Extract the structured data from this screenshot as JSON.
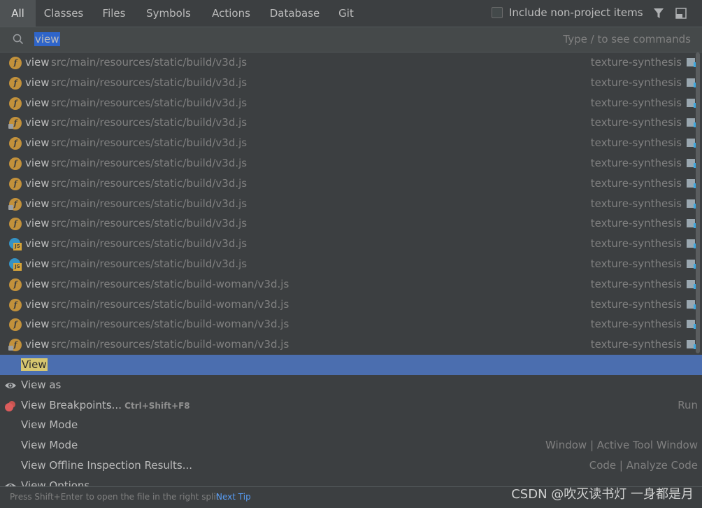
{
  "tabs": [
    {
      "label": "All",
      "active": true
    },
    {
      "label": "Classes"
    },
    {
      "label": "Files"
    },
    {
      "label": "Symbols"
    },
    {
      "label": "Actions"
    },
    {
      "label": "Database"
    },
    {
      "label": "Git"
    }
  ],
  "include_non_project": {
    "label": "Include non-project items",
    "checked": false
  },
  "search": {
    "value": "view",
    "hint": "Type / to see commands"
  },
  "results": [
    {
      "name": "view",
      "path": "src/main/resources/static/build/v3d.js",
      "module": "texture-synthesis",
      "icon": "function-icon"
    },
    {
      "name": "view",
      "path": "src/main/resources/static/build/v3d.js",
      "module": "texture-synthesis",
      "icon": "function-icon"
    },
    {
      "name": "view",
      "path": "src/main/resources/static/build/v3d.js",
      "module": "texture-synthesis",
      "icon": "function-icon"
    },
    {
      "name": "view",
      "path": "src/main/resources/static/build/v3d.js",
      "module": "texture-synthesis",
      "icon": "function-locked-icon"
    },
    {
      "name": "view",
      "path": "src/main/resources/static/build/v3d.js",
      "module": "texture-synthesis",
      "icon": "function-icon"
    },
    {
      "name": "view",
      "path": "src/main/resources/static/build/v3d.js",
      "module": "texture-synthesis",
      "icon": "function-icon"
    },
    {
      "name": "view",
      "path": "src/main/resources/static/build/v3d.js",
      "module": "texture-synthesis",
      "icon": "function-icon"
    },
    {
      "name": "view",
      "path": "src/main/resources/static/build/v3d.js",
      "module": "texture-synthesis",
      "icon": "function-locked-icon"
    },
    {
      "name": "view",
      "path": "src/main/resources/static/build/v3d.js",
      "module": "texture-synthesis",
      "icon": "function-icon"
    },
    {
      "name": "view",
      "path": "src/main/resources/static/build/v3d.js",
      "module": "texture-synthesis",
      "icon": "js-class-icon"
    },
    {
      "name": "view",
      "path": "src/main/resources/static/build/v3d.js",
      "module": "texture-synthesis",
      "icon": "js-class-icon"
    },
    {
      "name": "view",
      "path": "src/main/resources/static/build-woman/v3d.js",
      "module": "texture-synthesis",
      "icon": "function-icon"
    },
    {
      "name": "view",
      "path": "src/main/resources/static/build-woman/v3d.js",
      "module": "texture-synthesis",
      "icon": "function-icon"
    },
    {
      "name": "view",
      "path": "src/main/resources/static/build-woman/v3d.js",
      "module": "texture-synthesis",
      "icon": "function-icon"
    },
    {
      "name": "view",
      "path": "src/main/resources/static/build-woman/v3d.js",
      "module": "texture-synthesis",
      "icon": "function-locked-icon"
    }
  ],
  "actions": [
    {
      "label": "View",
      "shortcut": "",
      "right": "",
      "icon": "",
      "selected": true
    },
    {
      "label": "View as",
      "shortcut": "",
      "right": "",
      "icon": "eye-icon"
    },
    {
      "label": "View Breakpoints...",
      "shortcut": "Ctrl+Shift+F8",
      "right": "Run",
      "icon": "breakpoints-icon"
    },
    {
      "label": "View Mode",
      "shortcut": "",
      "right": "",
      "icon": ""
    },
    {
      "label": "View Mode",
      "shortcut": "",
      "right": "Window | Active Tool Window",
      "icon": ""
    },
    {
      "label": "View Offline Inspection Results...",
      "shortcut": "",
      "right": "Code | Analyze Code",
      "icon": ""
    },
    {
      "label": "View Options",
      "shortcut": "",
      "right": "",
      "icon": "eye-icon"
    }
  ],
  "footer": {
    "tip": "Press Shift+Enter to open the file in the right split",
    "next_tip": "Next Tip",
    "watermark": "CSDN @吹灭读书灯 一身都是月"
  },
  "colors": {
    "selection": "#4b6eaf",
    "highlight": "#d6c66f",
    "function_icon": "#c2913b",
    "link": "#589df6"
  }
}
